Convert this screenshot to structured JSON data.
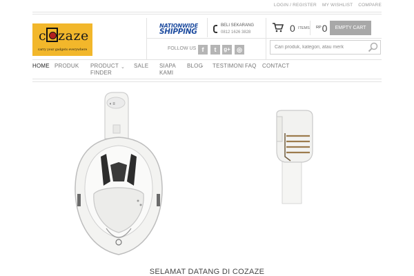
{
  "header": {
    "top_links": [
      "LOGIN / REGISTER",
      "MY WISHLIST",
      "COMPARE"
    ],
    "logo": {
      "word": "cozaze",
      "tagline": "carry your gadgets everywhere"
    },
    "shipping": {
      "line1": "NATIONWIDE",
      "line2": "SHIPPING"
    },
    "contact": {
      "label": "BELI SEKARANG",
      "phone": "0812 1626 3828"
    },
    "follow_label": "FOLLOW US",
    "social": [
      {
        "icon": "facebook-icon",
        "glyph": "f"
      },
      {
        "icon": "twitter-icon",
        "glyph": "t"
      },
      {
        "icon": "google-plus-icon",
        "glyph": "g+"
      },
      {
        "icon": "instagram-icon",
        "glyph": "◎"
      }
    ],
    "cart": {
      "count": "0",
      "items_label": "ITEMS",
      "currency": "RP",
      "total": "0",
      "button": "EMPTY CART"
    },
    "search": {
      "placeholder": "Cari produk, kategori, atau merk"
    }
  },
  "nav": {
    "home": "HOME",
    "produk": "PRODUK",
    "product_finder_1": "PRODUCT",
    "product_finder_2": "FINDER",
    "sale": "SALE",
    "siapa_1": "SIAPA",
    "siapa_2": "KAMI",
    "blog": "BLOG",
    "testimoni": "TESTIMONI",
    "faq": "FAQ",
    "contact": "CONTACT"
  },
  "products": [
    {
      "name": "full-face snorkel mask"
    },
    {
      "name": "snorkel tube valve"
    }
  ],
  "welcome": "SELAMAT DATANG DI COZAZE",
  "colors": {
    "brand_yellow": "#f2b72b",
    "shipping_blue": "#1f4da0",
    "button_gray": "#a8a8a8"
  }
}
